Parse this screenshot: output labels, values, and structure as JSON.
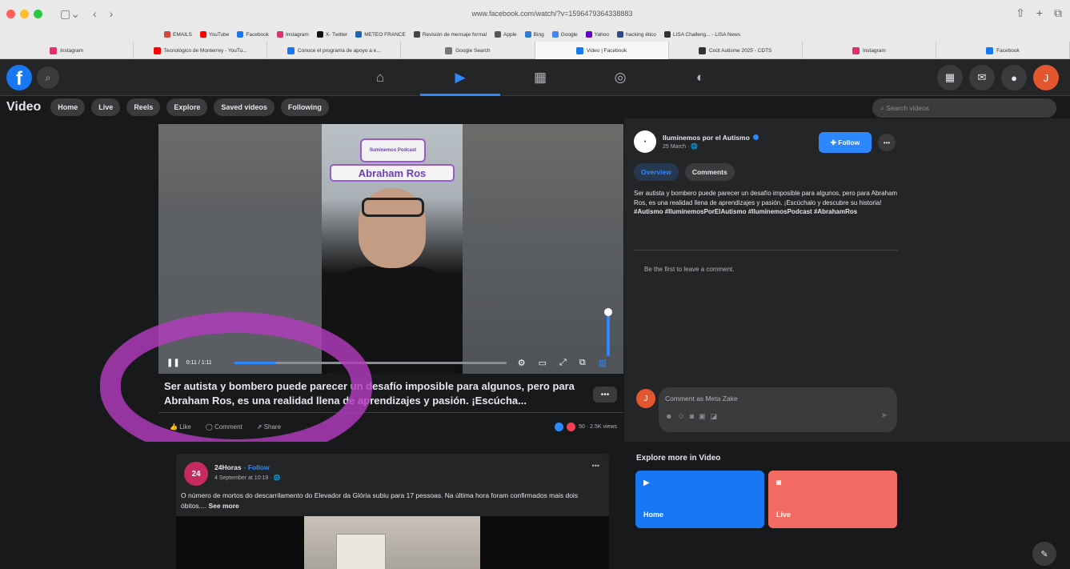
{
  "browser": {
    "url": "www.facebook.com/watch/?v=1596479364338883",
    "bookmarks": [
      {
        "label": "EMAILS",
        "color": "#d44638"
      },
      {
        "label": "YouTube",
        "color": "#ff0000"
      },
      {
        "label": "Facebook",
        "color": "#1877f2"
      },
      {
        "label": "Instagram",
        "color": "#e1306c"
      },
      {
        "label": "X- Twitter",
        "color": "#111111"
      },
      {
        "label": "METEO FRANCE",
        "color": "#1b66b1"
      },
      {
        "label": "Revisión de mensaje formal",
        "color": "#444444"
      },
      {
        "label": "Apple",
        "color": "#555555"
      },
      {
        "label": "Bing",
        "color": "#2f7ad6"
      },
      {
        "label": "Google",
        "color": "#4285f4"
      },
      {
        "label": "Yahoo",
        "color": "#6001d2"
      },
      {
        "label": "hacking ético",
        "color": "#2d4a8a"
      },
      {
        "label": "LISA Challeng... - LISA News",
        "color": "#333333"
      }
    ],
    "tabs": [
      {
        "label": "Instagram",
        "color": "#e1306c"
      },
      {
        "label": "Tecnológico de Monterrey - YouTu...",
        "color": "#ff0000"
      },
      {
        "label": "Conoce el programa de apoyo a e...",
        "color": "#1877f2"
      },
      {
        "label": "Google Search",
        "color": "#777777"
      },
      {
        "label": "Video | Facebook",
        "color": "#1877f2"
      },
      {
        "label": "Coût Autisme 2025 - CDTS",
        "color": "#333333"
      },
      {
        "label": "Instagram",
        "color": "#e1306c"
      },
      {
        "label": "Facebook",
        "color": "#1877f2"
      }
    ]
  },
  "video_page": {
    "title": "Video",
    "nav_pills": [
      "Home",
      "Live",
      "Reels",
      "Explore",
      "Saved videos",
      "Following"
    ],
    "search_placeholder": "Search videos"
  },
  "player": {
    "logo_text": "Iluminemos Podcast",
    "name_banner": "Abraham Ros",
    "timecode": "0:11 / 1:11",
    "progress": 0.155,
    "volume": 1.0
  },
  "caption": "Ser autista y bombero puede parecer un desafío imposible para algunos, pero para Abraham Ros, es una realidad llena de aprendizajes y pasión. ¡Escúcha...",
  "actions": {
    "like": "Like",
    "comment": "Comment",
    "share": "Share",
    "reactions_text": "50 · 2.5K views"
  },
  "side": {
    "author_name": "Iluminemos por el Autismo",
    "author_date": "25 March · 🌐",
    "follow_label": "Follow",
    "tabs": [
      "Overview",
      "Comments"
    ],
    "description": "Ser autista y bombero puede parecer un desafío imposible para algunos, pero para Abraham Ros, es una realidad llena de aprendizajes y pasión. ¡Escúchalo y descubre su historia!",
    "hashtags": "#Autismo #IluminemosPorElAutismo #IluminemosPodcast #AbrahamRos",
    "first_comment": "Be the first to leave a comment.",
    "comment_placeholder": "Comment as Meta Zake"
  },
  "post": {
    "author": "24Horas",
    "follow": "· Follow",
    "date": "4 September at 10:19 · 🌐",
    "text": "O número de mortos do descarrilamento do Elevador da Glória subiu para 17 pessoas. Na última hora foram confirmados mais dois óbitos....",
    "see_more": "See more"
  },
  "explore": {
    "title": "Explore more in Video",
    "tiles": [
      "Home",
      "Live"
    ]
  },
  "colors": {
    "accent": "#2d88ff",
    "annotation": "#b23cbe",
    "tile_home": "#1877f2",
    "tile_live": "#f36b62"
  }
}
